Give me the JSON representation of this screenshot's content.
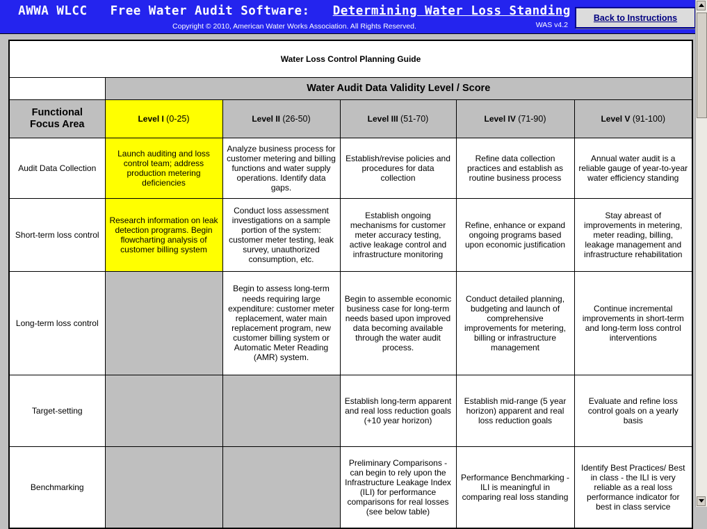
{
  "header": {
    "title_part1": "AWWA WLCC",
    "title_part2": "Free Water Audit Software:",
    "title_part3": "Determining Water Loss Standing",
    "copyright": "Copyright © 2010, American Water Works Association. All Rights Reserved.",
    "version": "WAS v4.2",
    "back_button": "Back to Instructions"
  },
  "table": {
    "title": "Water Loss Control Planning Guide",
    "validity_header": "Water Audit Data Validity Level / Score",
    "focus_header_line1": "Functional",
    "focus_header_line2": "Focus Area",
    "levels": [
      {
        "name": "Level I",
        "range": "(0-25)"
      },
      {
        "name": "Level II",
        "range": "(26-50)"
      },
      {
        "name": "Level III",
        "range": "(51-70)"
      },
      {
        "name": "Level IV",
        "range": "(71-90)"
      },
      {
        "name": "Level V",
        "range": "(91-100)"
      }
    ],
    "rows": [
      {
        "label": "Audit Data Collection",
        "cells": [
          {
            "text": "Launch auditing and loss control team; address production metering deficiencies",
            "fill": "yellow"
          },
          {
            "text": "Analyze business process for customer metering and billing functions and water supply operations. Identify data gaps.",
            "fill": "white"
          },
          {
            "text": "Establish/revise policies and procedures for data collection",
            "fill": "white"
          },
          {
            "text": "Refine data collection practices and establish as routine business process",
            "fill": "white"
          },
          {
            "text": "Annual water audit is a reliable gauge of year-to-year water efficiency standing",
            "fill": "white"
          }
        ]
      },
      {
        "label": "Short-term loss control",
        "cells": [
          {
            "text": "Research information on leak detection programs.  Begin flowcharting analysis of customer billing system",
            "fill": "yellow"
          },
          {
            "text": "Conduct loss assessment investigations on a sample portion of the system: customer meter testing, leak survey, unauthorized consumption, etc.",
            "fill": "white"
          },
          {
            "text": "Establish ongoing mechanisms for customer meter accuracy testing, active leakage control and infrastructure monitoring",
            "fill": "white"
          },
          {
            "text": "Refine, enhance or expand ongoing programs based upon economic justification",
            "fill": "white"
          },
          {
            "text": "Stay abreast of improvements in metering, meter reading, billing, leakage management and infrastructure rehabilitation",
            "fill": "white"
          }
        ]
      },
      {
        "label": "Long-term loss control",
        "cells": [
          {
            "text": "",
            "fill": "gray"
          },
          {
            "text": "Begin to assess long-term needs requiring large expenditure: customer meter replacement, water main replacement program, new customer billing system or Automatic Meter Reading (AMR) system.",
            "fill": "white"
          },
          {
            "text": "Begin to assemble economic business case for long-term needs based upon improved data becoming available through the water audit process.",
            "fill": "white"
          },
          {
            "text": "Conduct detailed planning, budgeting and launch of comprehensive improvements for metering, billing or infrastructure management",
            "fill": "white"
          },
          {
            "text": "Continue incremental improvements in short-term and long-term loss control interventions",
            "fill": "white"
          }
        ]
      },
      {
        "label": "Target-setting",
        "cells": [
          {
            "text": "",
            "fill": "gray"
          },
          {
            "text": "",
            "fill": "gray"
          },
          {
            "text": "Establish long-term apparent and real loss reduction goals (+10 year horizon)",
            "fill": "white"
          },
          {
            "text": "Establish mid-range (5 year horizon) apparent and real loss reduction goals",
            "fill": "white"
          },
          {
            "text": "Evaluate and refine loss control goals on a yearly basis",
            "fill": "white"
          }
        ]
      },
      {
        "label": "Benchmarking",
        "cells": [
          {
            "text": "",
            "fill": "gray"
          },
          {
            "text": "",
            "fill": "gray"
          },
          {
            "text": "Preliminary Comparisons - can begin to rely upon the Infrastructure Leakage Index (ILI) for performance comparisons for real losses (see below table)",
            "fill": "white"
          },
          {
            "text": "Performance Benchmarking - ILI is meaningful in comparing real loss standing",
            "fill": "white"
          },
          {
            "text": "Identify Best Practices/ Best in class - the ILI is very reliable as a real loss performance indicator for best in class service",
            "fill": "white"
          }
        ]
      }
    ]
  },
  "colors": {
    "header_blue": "#2424ee",
    "highlight_yellow": "#ffff00",
    "disabled_gray": "#bfbfbf"
  }
}
